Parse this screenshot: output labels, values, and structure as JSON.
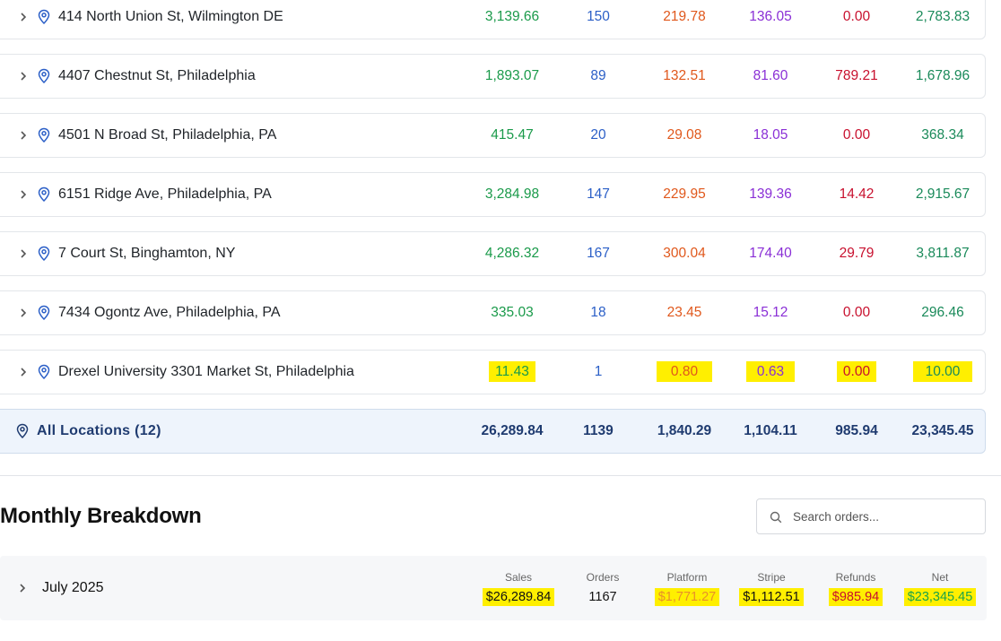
{
  "locations": [
    {
      "address": "414 North Union St, Wilmington DE",
      "sales": "3,139.66",
      "orders": "150",
      "platform": "219.78",
      "stripe": "136.05",
      "refunds": "0.00",
      "net": "2,783.83"
    },
    {
      "address": "4407 Chestnut St, Philadelphia",
      "sales": "1,893.07",
      "orders": "89",
      "platform": "132.51",
      "stripe": "81.60",
      "refunds": "789.21",
      "net": "1,678.96"
    },
    {
      "address": "4501 N Broad St, Philadelphia, PA",
      "sales": "415.47",
      "orders": "20",
      "platform": "29.08",
      "stripe": "18.05",
      "refunds": "0.00",
      "net": "368.34"
    },
    {
      "address": "6151 Ridge Ave, Philadelphia, PA",
      "sales": "3,284.98",
      "orders": "147",
      "platform": "229.95",
      "stripe": "139.36",
      "refunds": "14.42",
      "net": "2,915.67"
    },
    {
      "address": "7 Court St, Binghamton, NY",
      "sales": "4,286.32",
      "orders": "167",
      "platform": "300.04",
      "stripe": "174.40",
      "refunds": "29.79",
      "net": "3,811.87"
    },
    {
      "address": "7434 Ogontz Ave, Philadelphia, PA",
      "sales": "335.03",
      "orders": "18",
      "platform": "23.45",
      "stripe": "15.12",
      "refunds": "0.00",
      "net": "296.46"
    },
    {
      "address": "Drexel University 3301 Market St, Philadelphia",
      "sales": "11.43",
      "orders": "1",
      "platform": "0.80",
      "stripe": "0.63",
      "refunds": "0.00",
      "net": "10.00"
    }
  ],
  "total": {
    "label": "All Locations (12)",
    "sales": "26,289.84",
    "orders": "1139",
    "platform": "1,840.29",
    "stripe": "1,104.11",
    "refunds": "985.94",
    "net": "23,345.45"
  },
  "monthly": {
    "title": "Monthly Breakdown",
    "search_placeholder": "Search orders...",
    "rows": [
      {
        "month": "July 2025",
        "labels": {
          "sales": "Sales",
          "orders": "Orders",
          "platform": "Platform",
          "stripe": "Stripe",
          "refunds": "Refunds",
          "net": "Net"
        },
        "sales": "$26,289.84",
        "orders": "1167",
        "platform": "$1,771.27",
        "stripe": "$1,112.51",
        "refunds": "$985.94",
        "net": "$23,345.45"
      }
    ]
  },
  "colors": {
    "highlight": "#ffef00",
    "sales": "#1a9a4a",
    "orders": "#2b5fc7",
    "platform": "#e0581c",
    "stripe": "#8a2fd6",
    "refunds": "#c8102e",
    "net": "#1a8a5a"
  },
  "icons": [
    "chevron-right-icon",
    "map-pin-icon",
    "search-icon"
  ]
}
